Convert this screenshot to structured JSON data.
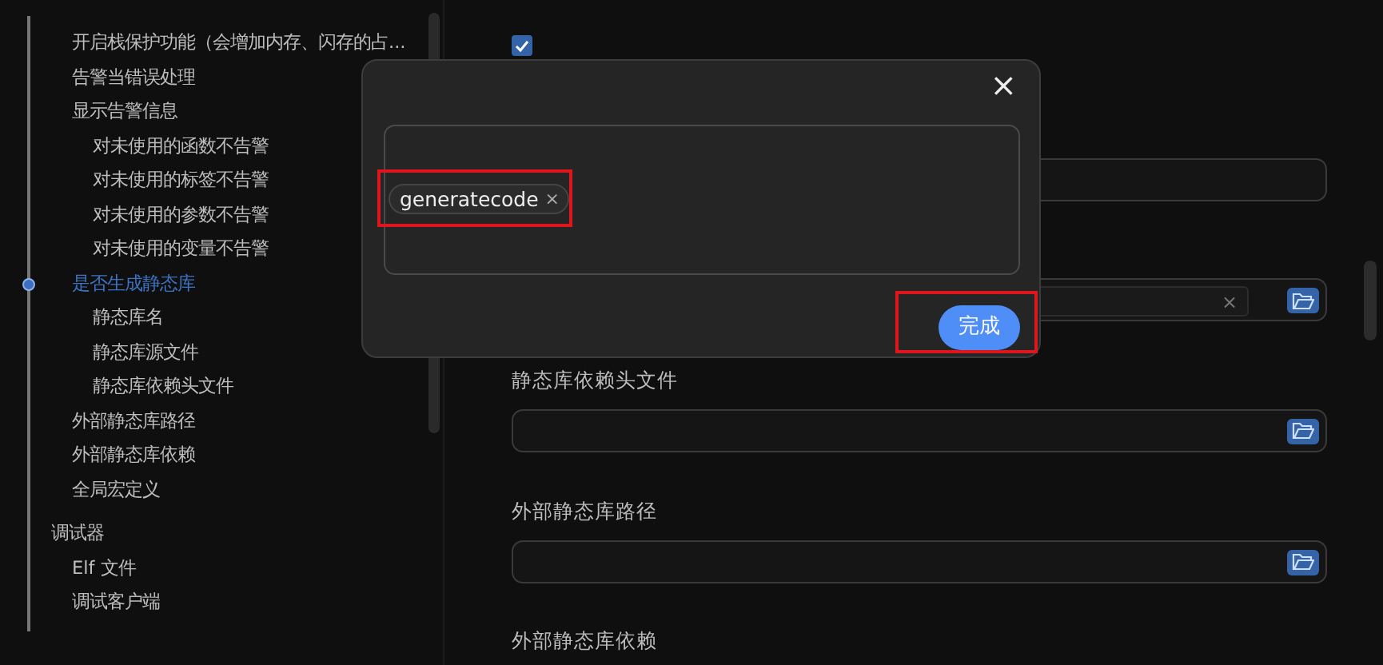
{
  "sidebar": {
    "sections": [
      {
        "items": [
          {
            "label": "开启栈保护功能（会增加内存、闪存的占...",
            "selected": false
          },
          {
            "label": "告警当错误处理",
            "selected": false
          },
          {
            "label": "显示告警信息",
            "selected": false,
            "children": [
              {
                "label": "对未使用的函数不告警",
                "selected": false
              },
              {
                "label": "对未使用的标签不告警",
                "selected": false
              },
              {
                "label": "对未使用的参数不告警",
                "selected": false
              },
              {
                "label": "对未使用的变量不告警",
                "selected": false
              }
            ]
          },
          {
            "label": "是否生成静态库",
            "selected": true,
            "children": [
              {
                "label": "静态库名",
                "selected": false
              },
              {
                "label": "静态库源文件",
                "selected": false
              },
              {
                "label": "静态库依赖头文件",
                "selected": false
              }
            ]
          },
          {
            "label": "外部静态库路径",
            "selected": false
          },
          {
            "label": "外部静态库依赖",
            "selected": false
          },
          {
            "label": "全局宏定义",
            "selected": false
          }
        ]
      },
      {
        "title": "调试器",
        "items": [
          {
            "label": "Elf 文件",
            "selected": false
          },
          {
            "label": "调试客户端",
            "selected": false
          }
        ]
      }
    ]
  },
  "form": {
    "checkbox": {
      "checked": true
    },
    "fields": [
      {
        "kind": "text"
      },
      {
        "kind": "list",
        "clear": "×"
      },
      {
        "kind": "file",
        "label": "静态库依赖头文件"
      },
      {
        "kind": "file",
        "label": "外部静态库路径"
      },
      {
        "kind": "heading",
        "label": "外部静态库依赖"
      }
    ]
  },
  "dialog": {
    "close": "×",
    "tags": [
      {
        "label": "generatecode",
        "remove": "×"
      }
    ],
    "button": "完成"
  }
}
